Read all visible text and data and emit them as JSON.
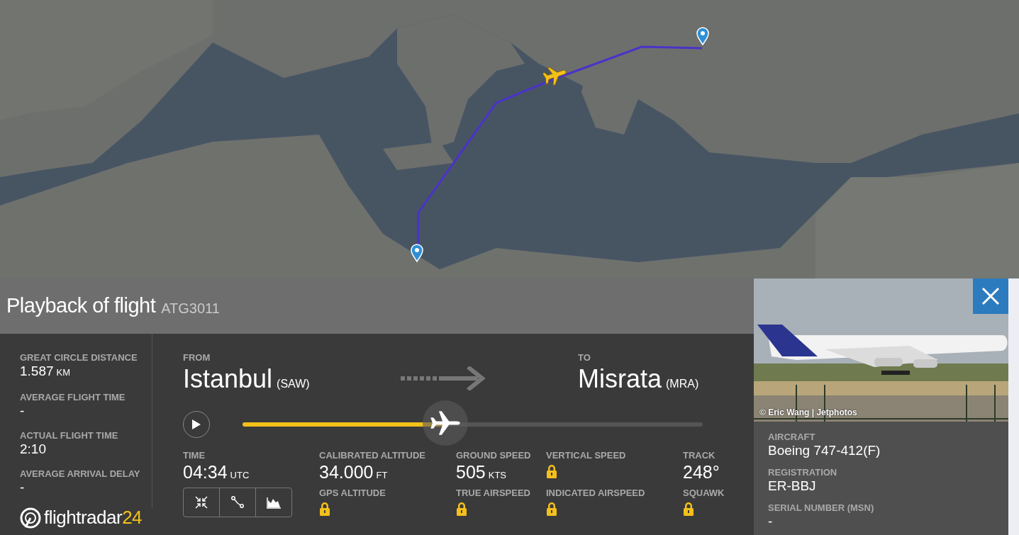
{
  "title": {
    "text": "Playback of flight",
    "flight": "ATG3011"
  },
  "summary": [
    {
      "label": "GREAT CIRCLE DISTANCE",
      "value": "1.587",
      "unit": "KM"
    },
    {
      "label": "AVERAGE FLIGHT TIME",
      "value": "-"
    },
    {
      "label": "ACTUAL FLIGHT TIME",
      "value": "2:10"
    },
    {
      "label": "AVERAGE ARRIVAL DELAY",
      "value": "-"
    }
  ],
  "logo": {
    "text": "flightradar",
    "accent": "24"
  },
  "route": {
    "from": {
      "label": "FROM",
      "city": "Istanbul",
      "code": "(SAW)"
    },
    "to": {
      "label": "TO",
      "city": "Misrata",
      "code": "(MRA)"
    }
  },
  "playback": {
    "level": 0.44
  },
  "stats": [
    {
      "fields": [
        {
          "kind": "value",
          "label": "TIME",
          "value": "04:34",
          "unit": "UTC"
        }
      ],
      "view_buttons": true
    },
    {
      "fields": [
        {
          "kind": "value",
          "label": "CALIBRATED ALTITUDE",
          "value": "34.000",
          "unit": "FT"
        },
        {
          "kind": "locked",
          "label": "GPS ALTITUDE"
        }
      ]
    },
    {
      "fields": [
        {
          "kind": "value",
          "label": "GROUND SPEED",
          "value": "505",
          "unit": "KTS"
        },
        {
          "kind": "locked",
          "label": "TRUE AIRSPEED"
        }
      ]
    },
    {
      "fields": [
        {
          "kind": "locked",
          "label": "VERTICAL SPEED"
        },
        {
          "kind": "locked",
          "label": "INDICATED AIRSPEED"
        }
      ]
    },
    {
      "fields": [
        {
          "kind": "value",
          "label": "TRACK",
          "value": "248°"
        },
        {
          "kind": "locked",
          "label": "SQUAWK"
        }
      ]
    }
  ],
  "aircraft": {
    "photo_credit": "© Eric Wang | Jetphotos",
    "fields": [
      {
        "label": "AIRCRAFT",
        "value": "Boeing 747-412(F)"
      },
      {
        "label": "REGISTRATION",
        "value": "ER-BBJ"
      },
      {
        "label": "SERIAL NUMBER (MSN)",
        "value": "-"
      }
    ]
  }
}
